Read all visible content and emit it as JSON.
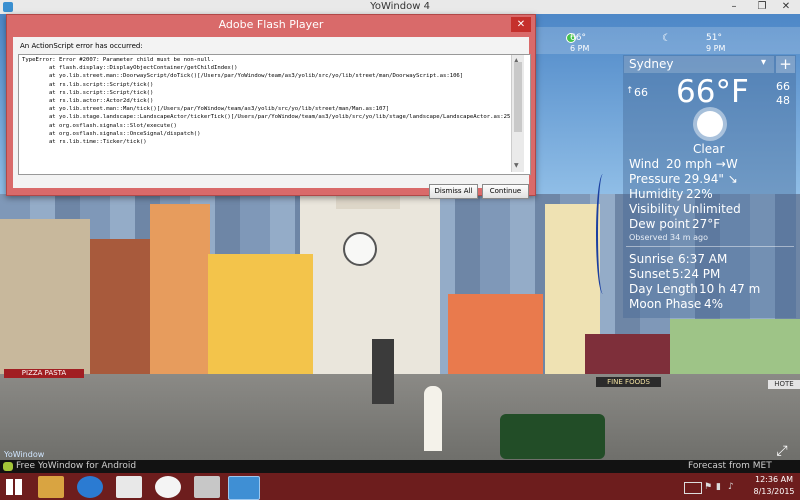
{
  "window": {
    "title": "YoWindow 4",
    "minimize": "–",
    "maximize": "❐",
    "close": "✕"
  },
  "timeline": [
    {
      "temp": "66°",
      "time": "6 PM"
    },
    {
      "temp": "51°",
      "time": "9 PM"
    }
  ],
  "weather": {
    "city": "Sydney",
    "menu_glyph": "▾",
    "add_glyph": "+",
    "temp": "66°F",
    "left_temp": "66",
    "high": "66",
    "low": "48",
    "condition": "Clear",
    "wind_label": "Wind",
    "wind_value": "20 mph →W",
    "pressure_label": "Pressure",
    "pressure_value": "29.94\" ↘",
    "humidity_label": "Humidity",
    "humidity_value": "22%",
    "visibility_label": "Visibility",
    "visibility_value": "Unlimited",
    "dew_label": "Dew point",
    "dew_value": "27°F",
    "observed": "Observed  34 m ago",
    "sunrise_label": "Sunrise",
    "sunrise_value": "6:37 AM",
    "sunset_label": "Sunset",
    "sunset_value": "5:24 PM",
    "daylength_label": "Day Length",
    "daylength_value": "10 h 47 m",
    "moon_label": "Moon Phase",
    "moon_value": "4%"
  },
  "scene_signs": {
    "pizza": "PIZZA PASTA",
    "fine_foods": "FINE FOODS",
    "hotel": "HOTE"
  },
  "dialog": {
    "title": "Adobe Flash Player",
    "close": "✕",
    "message": "An ActionScript error has occurred:",
    "trace": "TypeError: Error #2007: Parameter child must be non-null.\n        at flash.display::DisplayObjectContainer/getChildIndex()\n        at yo.lib.street.man::DoorwayScript/doTick()[/Users/par/YoWindow/team/as3/yolib/src/yo/lib/street/man/DoorwayScript.as:106]\n        at rs.lib.script::Script/tick()\n        at rs.lib.script::Script/tick()\n        at rs.lib.actor::Actor2d/tick()\n        at yo.lib.street.man::Man/tick()[/Users/par/YoWindow/team/as3/yolib/src/yo/lib/street/man/Man.as:107]\n        at yo.lib.stage.landscape::LandscapeActor/tickerTick()[/Users/par/YoWindow/team/as3/yolib/src/yo/lib/stage/landscape/LandscapeActor.as:25]\n        at org.osflash.signals::Slot/execute()\n        at org.osflash.signals::OnceSignal/dispatch()\n        at rs.lib.time::Ticker/tick()",
    "dismiss_label": "Dismiss All",
    "continue_label": "Continue"
  },
  "watermark": "YoWindow",
  "bottom": {
    "ad": "Free YoWindow for Android",
    "forecast": "Forecast from MET Norway"
  },
  "tray": {
    "time": "12:36 AM",
    "date": "8/13/2015"
  }
}
